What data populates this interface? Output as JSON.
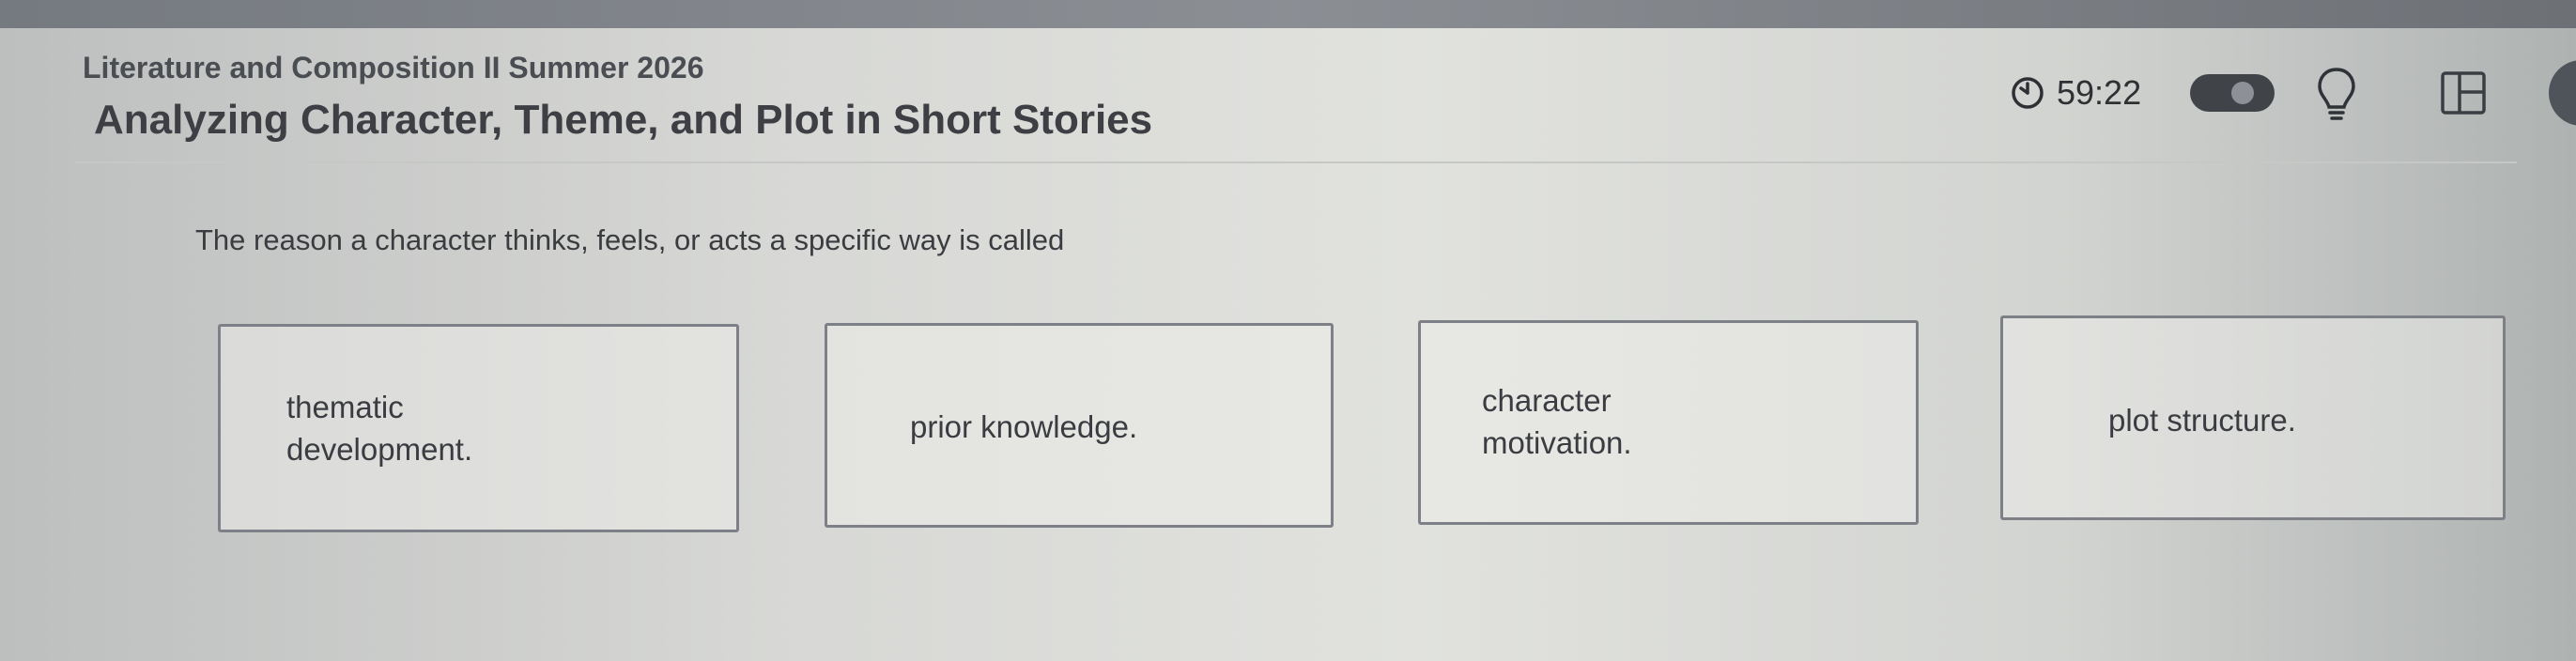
{
  "header": {
    "course_title": "Literature and Composition II Summer 2026",
    "lesson_title": "Analyzing Character, Theme, and Plot in Short Stories"
  },
  "toolbar": {
    "timer": "59:22",
    "icons": [
      "timer-icon",
      "toggle-switch",
      "lightbulb-icon",
      "layout-icon"
    ]
  },
  "question": {
    "prompt": "The reason a character thinks, feels, or acts a specific way is called",
    "choices": [
      {
        "line1": "thematic",
        "line2": "development."
      },
      {
        "line1": "prior knowledge.",
        "line2": ""
      },
      {
        "line1": "character",
        "line2": "motivation."
      },
      {
        "line1": "plot structure.",
        "line2": ""
      }
    ]
  },
  "colors": {
    "text": "#3a3c41",
    "border": "#7d8086",
    "toggle": "#404449"
  }
}
